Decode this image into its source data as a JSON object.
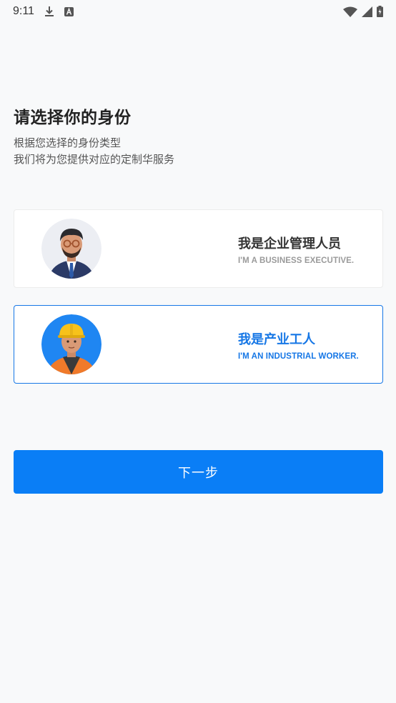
{
  "status_bar": {
    "time": "9:11",
    "icons": [
      "download-icon",
      "a-notification-icon",
      "wifi-icon",
      "signal-icon",
      "battery-icon"
    ]
  },
  "page": {
    "title": "请选择你的身份",
    "subtitle_line1": "根据您选择的身份类型",
    "subtitle_line2": "我们将为您提供对应的定制华服务"
  },
  "options": [
    {
      "title": "我是企业管理人员",
      "subtitle": "I'M A BUSINESS EXECUTIVE.",
      "selected": false,
      "avatar": "executive-avatar"
    },
    {
      "title": "我是产业工人",
      "subtitle": "I'M AN INDUSTRIAL WORKER.",
      "selected": true,
      "avatar": "worker-avatar"
    }
  ],
  "next_button": {
    "label": "下一步"
  },
  "colors": {
    "accent": "#0a7ef6",
    "selected_border": "#1677e6",
    "background": "#f8f9fa"
  }
}
